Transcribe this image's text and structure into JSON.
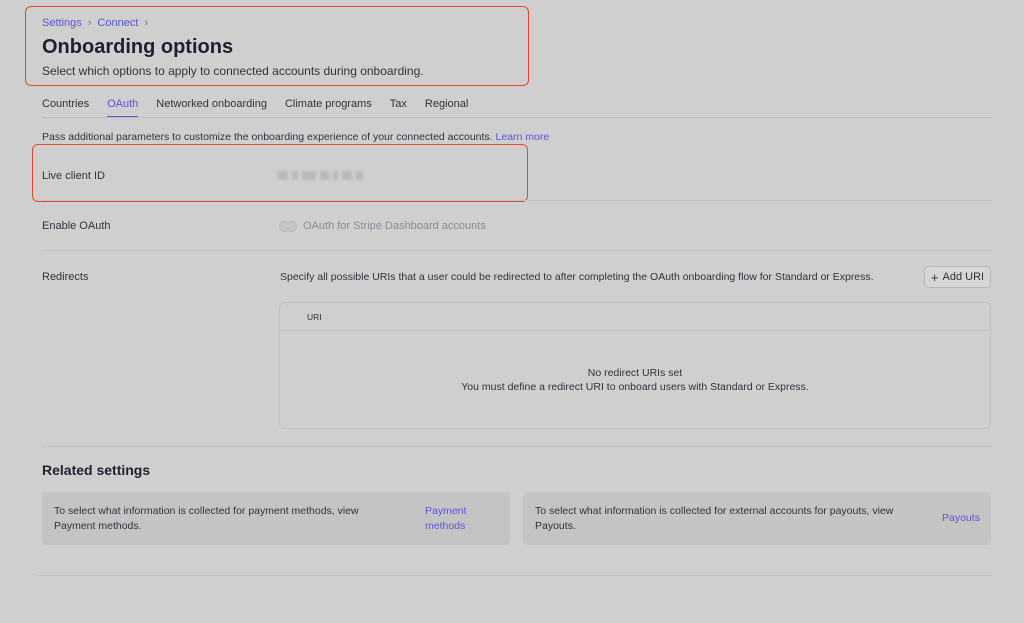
{
  "breadcrumb": [
    "Settings",
    "Connect"
  ],
  "page_title": "Onboarding options",
  "page_subtitle": "Select which options to apply to connected accounts during onboarding.",
  "tabs": [
    {
      "label": "Countries",
      "active": false
    },
    {
      "label": "OAuth",
      "active": true
    },
    {
      "label": "Networked onboarding",
      "active": false
    },
    {
      "label": "Climate programs",
      "active": false
    },
    {
      "label": "Tax",
      "active": false
    },
    {
      "label": "Regional",
      "active": false
    }
  ],
  "description": {
    "text": "Pass additional parameters to customize the onboarding experience of your connected accounts.",
    "link": "Learn more"
  },
  "live_client_id": {
    "label": "Live client ID",
    "value_redacted": true
  },
  "enable_oauth": {
    "label": "Enable OAuth",
    "toggle_label": "OAuth for Stripe Dashboard accounts",
    "enabled": false
  },
  "redirects": {
    "label": "Redirects",
    "description": "Specify all possible URIs that a user could be redirected to after completing the OAuth onboarding flow for Standard or Express.",
    "add_button": "Add URI",
    "add_icon": "plus-icon",
    "table_header": "URI",
    "empty_title": "No redirect URIs set",
    "empty_subtitle": "You must define a redirect URI to onboard users with Standard or Express."
  },
  "related": {
    "title": "Related settings",
    "cards": [
      {
        "text": "To select what information is collected for payment methods, view Payment methods.",
        "link_line1": "Payment",
        "link_line2": "methods"
      },
      {
        "text": "To select what information is collected for external accounts for payouts, view Payouts.",
        "link": "Payouts"
      }
    ]
  },
  "colors": {
    "accent": "#5b55d6",
    "highlight": "#e5472b",
    "background": "#cfcfcf"
  }
}
